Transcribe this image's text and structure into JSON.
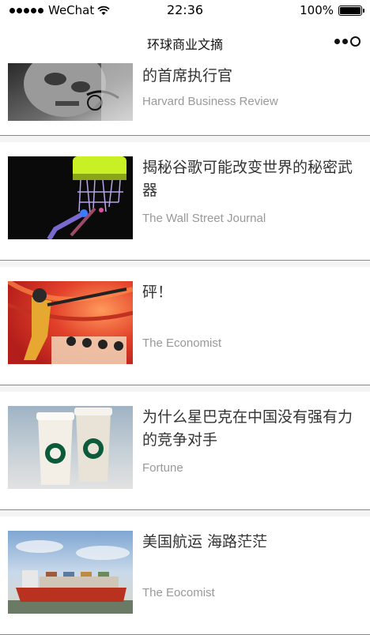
{
  "status_bar": {
    "carrier": "WeChat",
    "time": "22:36",
    "battery_percent": "100%",
    "battery_level": 1.0,
    "signal_icon": "signal-dots-icon",
    "wifi_icon": "wifi-icon"
  },
  "nav": {
    "title": "环球商业文摘",
    "more_icon": "more-options-icon"
  },
  "articles": [
    {
      "title": "的首席执行官",
      "source": "Harvard Business Review",
      "image": "man-with-glasses-photo"
    },
    {
      "title": "揭秘谷歌可能改变世界的秘密武器",
      "source": "The Wall Street Journal",
      "image": "quantum-chip-photo"
    },
    {
      "title": "砰！",
      "source": "The Economist",
      "image": "comic-illustration"
    },
    {
      "title": "为什么星巴克在中国没有强有力的竞争对手",
      "source": "Fortune",
      "image": "starbucks-cups-photo"
    },
    {
      "title": "美国航运 海路茫茫",
      "source": "The Eocomist",
      "image": "cargo-ship-photo"
    }
  ]
}
